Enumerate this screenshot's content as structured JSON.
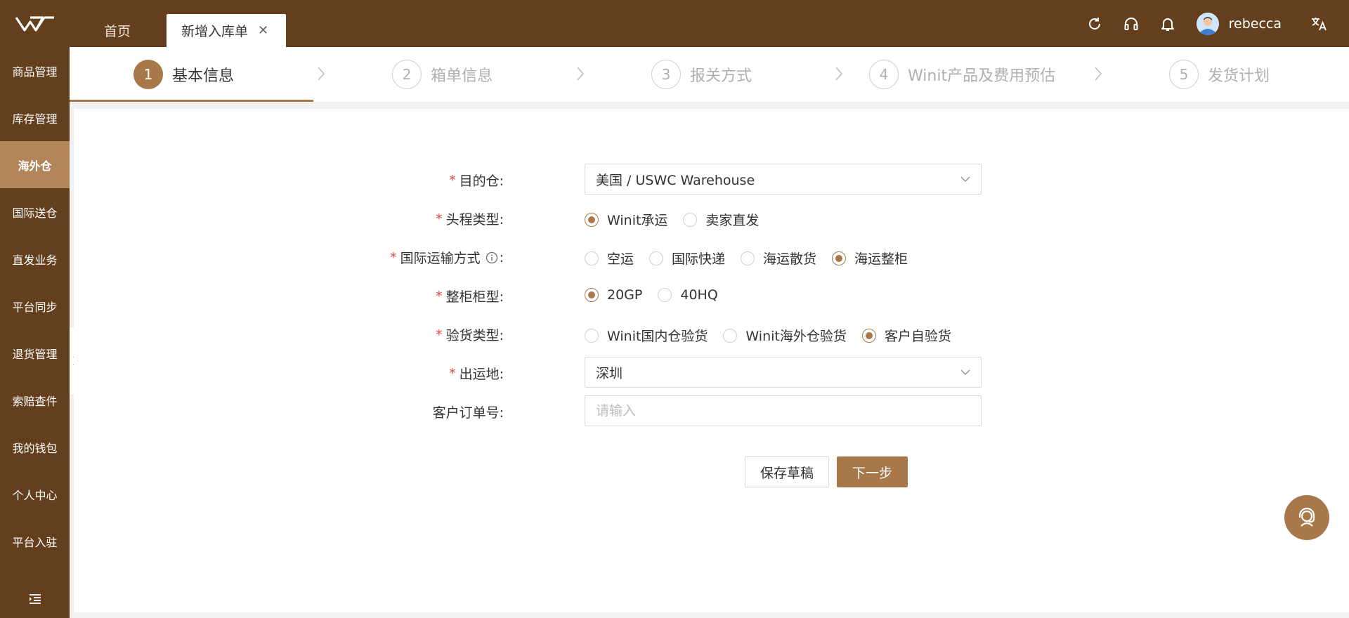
{
  "header": {
    "tabs": [
      {
        "label": "首页"
      },
      {
        "label": "新增入库单"
      }
    ],
    "user": {
      "name": "rebecca"
    },
    "close_glyph": "✕"
  },
  "sidebar": {
    "items": [
      {
        "label": "商品管理"
      },
      {
        "label": "库存管理"
      },
      {
        "label": "海外仓"
      },
      {
        "label": "国际送仓"
      },
      {
        "label": "直发业务"
      },
      {
        "label": "平台同步"
      },
      {
        "label": "退货管理"
      },
      {
        "label": "索赔查件"
      },
      {
        "label": "我的钱包"
      },
      {
        "label": "个人中心"
      },
      {
        "label": "平台入驻"
      }
    ],
    "active_index": 2
  },
  "steps": [
    {
      "num": "1",
      "label": "基本信息"
    },
    {
      "num": "2",
      "label": "箱单信息"
    },
    {
      "num": "3",
      "label": "报关方式"
    },
    {
      "num": "4",
      "label": "Winit产品及费用预估"
    },
    {
      "num": "5",
      "label": "发货计划"
    }
  ],
  "form": {
    "required_mark": "*",
    "destination": {
      "label": "目的仓:",
      "value": "美国 / USWC Warehouse"
    },
    "first_leg": {
      "label": "头程类型:",
      "options": [
        "Winit承运",
        "卖家直发"
      ],
      "selected": 0
    },
    "intl_transport": {
      "label": "国际运输方式",
      "colon": ":",
      "options": [
        "空运",
        "国际快递",
        "海运散货",
        "海运整柜"
      ],
      "selected": 3
    },
    "container_type": {
      "label": "整柜柜型:",
      "options": [
        "20GP",
        "40HQ"
      ],
      "selected": 0
    },
    "inspection_type": {
      "label": "验货类型:",
      "options": [
        "Winit国内仓验货",
        "Winit海外仓验货",
        "客户自验货"
      ],
      "selected": 2
    },
    "origin": {
      "label": "出运地:",
      "value": "深圳"
    },
    "customer_order": {
      "label": "客户订单号:",
      "placeholder": "请输入"
    }
  },
  "buttons": {
    "save_draft": "保存草稿",
    "next": "下一步"
  },
  "colors": {
    "brand_dark": "#643f1d",
    "accent": "#a9784a",
    "sidebar_active": "#b2865a"
  }
}
